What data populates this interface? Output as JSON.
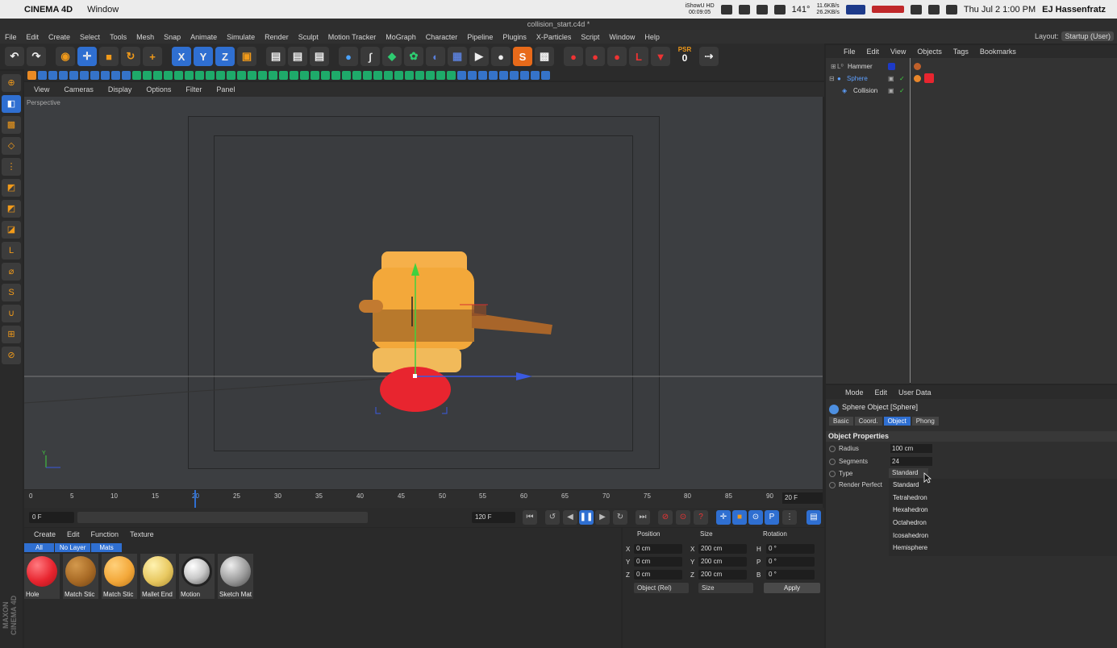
{
  "macbar": {
    "app_name": "CINEMA 4D",
    "menu_window": "Window",
    "ishowu_line1": "iShowU HD",
    "ishowu_line2": "00:09:05",
    "temp": "141°",
    "net_line1": "11.6KB/s",
    "net_line2": "26.2KB/s",
    "datetime": "Thu Jul 2  1:00 PM",
    "user": "EJ Hassenfratz"
  },
  "window_title": "collision_start.c4d *",
  "menu": [
    "File",
    "Edit",
    "Create",
    "Select",
    "Tools",
    "Mesh",
    "Snap",
    "Animate",
    "Simulate",
    "Render",
    "Sculpt",
    "Motion Tracker",
    "MoGraph",
    "Character",
    "Pipeline",
    "Plugins",
    "X-Particles",
    "Script",
    "Window",
    "Help"
  ],
  "layout": {
    "label": "Layout:",
    "value": "Startup (User)"
  },
  "toolbar": {
    "axis_x": "X",
    "axis_y": "Y",
    "axis_z": "Z",
    "psr_label": "PSR",
    "psr_value": "0"
  },
  "viewport": {
    "menu": [
      "View",
      "Cameras",
      "Display",
      "Options",
      "Filter",
      "Panel"
    ],
    "label": "Perspective"
  },
  "timeline": {
    "ticks": [
      "0",
      "5",
      "10",
      "15",
      "20",
      "25",
      "30",
      "35",
      "40",
      "45",
      "50",
      "55",
      "60",
      "65",
      "70",
      "75",
      "80",
      "85",
      "90"
    ],
    "current_frame": "20 F",
    "start_frame": "0 F",
    "end_frame": "120 F"
  },
  "materials": {
    "menu": [
      "Create",
      "Edit",
      "Function",
      "Texture"
    ],
    "filters": [
      "All",
      "No Layer",
      "Mats"
    ],
    "items": [
      {
        "name": "Hole",
        "color": "#e8252f"
      },
      {
        "name": "Match Stic",
        "color": "#a86a25"
      },
      {
        "name": "Match Stic",
        "color": "#f3a83a"
      },
      {
        "name": "Mallet End",
        "color": "#e8c860"
      },
      {
        "name": "Motion",
        "color": "#c8c8c8"
      },
      {
        "name": "Sketch Mat",
        "color": "#9a9a9a"
      }
    ]
  },
  "coords": {
    "headers": [
      "Position",
      "Size",
      "Rotation"
    ],
    "pos": [
      "0 cm",
      "0 cm",
      "0 cm"
    ],
    "size": [
      "200 cm",
      "200 cm",
      "200 cm"
    ],
    "rot": [
      "0 °",
      "0 °",
      "0 °"
    ],
    "axes_left": [
      "X",
      "Y",
      "Z"
    ],
    "axes_mid": [
      "X",
      "Y",
      "Z"
    ],
    "axes_right": [
      "H",
      "P",
      "B"
    ],
    "mode": "Object (Rel)",
    "size_mode": "Size",
    "apply": "Apply"
  },
  "objects": {
    "menu": [
      "File",
      "Edit",
      "View",
      "Objects",
      "Tags",
      "Bookmarks"
    ],
    "rows": [
      {
        "name": "Hammer",
        "selected": false
      },
      {
        "name": "Sphere",
        "selected": true
      },
      {
        "name": "Collision",
        "selected": false
      }
    ]
  },
  "attributes": {
    "menu": [
      "Mode",
      "Edit",
      "User Data"
    ],
    "title": "Sphere Object [Sphere]",
    "tabs": [
      "Basic",
      "Coord.",
      "Object",
      "Phong"
    ],
    "active_tab": "Object",
    "section": "Object Properties",
    "props": [
      {
        "label": "Radius",
        "value": "100 cm"
      },
      {
        "label": "Segments",
        "value": "24"
      },
      {
        "label": "Type",
        "value": "Standard"
      },
      {
        "label": "Render Perfect",
        "value": ""
      }
    ],
    "type_options": [
      "Standard",
      "Tetrahedron",
      "Hexahedron",
      "Octahedron",
      "Icosahedron",
      "Hemisphere"
    ]
  },
  "colors": {
    "accent": "#2f6fd1",
    "orange": "#f19a1a",
    "sphere_red": "#e8252f",
    "hammer_gold": "#f3a83a"
  }
}
